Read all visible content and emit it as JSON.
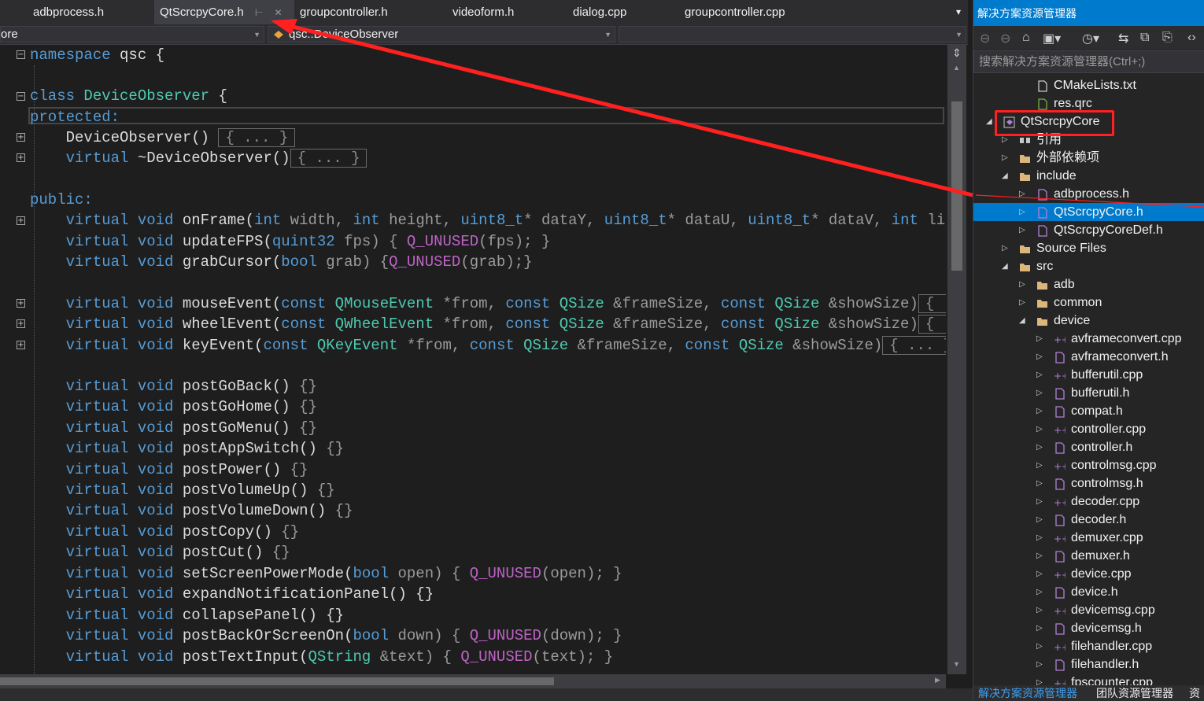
{
  "tabs": [
    {
      "label": "adbprocess.h"
    },
    {
      "label": "QtScrcpyCore.h",
      "pin": "⊢",
      "close": "✕"
    },
    {
      "label": "groupcontroller.h"
    },
    {
      "label": "videoform.h"
    },
    {
      "label": "dialog.cpp"
    },
    {
      "label": "groupcontroller.cpp"
    }
  ],
  "tab_menu_icon": "▾",
  "nav": {
    "project": "ore",
    "scope": "qsc::DeviceObserver",
    "member": ""
  },
  "code_lines": {
    "l1_kw": "namespace",
    "l1_rest": " qsc {",
    "l3_kw": "class",
    "l3_ty": "DeviceObserver",
    "l3_rest": " {",
    "l4": "protected:",
    "l5_name": "    DeviceObserver()",
    "l5_box": "{ ... }",
    "l6_kw": "    virtual",
    "l6_name": " ~DeviceObserver()",
    "l6_box": "{ ... }",
    "l8": "public:",
    "l9_a": "    virtual void",
    "l9_b": " onFrame(",
    "l9_c": "int",
    "l9_d": " width, ",
    "l9_e": "int",
    "l9_f": " height, ",
    "l9_g": "uint8_t",
    "l9_h": "* dataY, ",
    "l9_i": "uint8_t",
    "l9_j": "* dataU, ",
    "l9_k": "uint8_t",
    "l9_l": "* dataV, ",
    "l9_m": "int",
    "l9_n": " linesizeY",
    "l10_a": "    virtual void",
    "l10_b": " updateFPS(",
    "l10_c": "quint32",
    "l10_d": " fps) { ",
    "l10_e": "Q_UNUSED",
    "l10_f": "(fps); }",
    "l11_a": "    virtual void",
    "l11_b": " grabCursor(",
    "l11_c": "bool",
    "l11_d": " grab) {",
    "l11_e": "Q_UNUSED",
    "l11_f": "(grab);}",
    "l13_a": "    virtual void",
    "l13_b": " mouseEvent(",
    "l13_c": "const",
    "l13_d": " QMouseEvent",
    "l13_e": " *from, ",
    "l13_f": "const",
    "l13_g": " QSize",
    "l13_h": " &frameSize, ",
    "l13_i": "const",
    "l13_j": " QSize",
    "l13_k": " &showSize)",
    "l13_box": "{ ... }",
    "l14_a": "    virtual void",
    "l14_b": " wheelEvent(",
    "l14_c": "const",
    "l14_d": " QWheelEvent",
    "l14_e": " *from, ",
    "l14_f": "const",
    "l14_g": " QSize",
    "l14_h": " &frameSize, ",
    "l14_i": "const",
    "l14_j": " QSize",
    "l14_k": " &showSize)",
    "l14_box": "{ ... }",
    "l15_a": "    virtual void",
    "l15_b": " keyEvent(",
    "l15_c": "const",
    "l15_d": " QKeyEvent",
    "l15_e": " *from, ",
    "l15_f": "const",
    "l15_g": " QSize",
    "l15_h": " &frameSize, ",
    "l15_i": "const",
    "l15_j": " QSize",
    "l15_k": " &showSize)",
    "l15_box": "{ ... }"
  },
  "simple_methods": [
    {
      "kw": "    virtual void",
      "name": " postGoBack()",
      "body": " {}"
    },
    {
      "kw": "    virtual void",
      "name": " postGoHome()",
      "body": " {}"
    },
    {
      "kw": "    virtual void",
      "name": " postGoMenu()",
      "body": " {}"
    },
    {
      "kw": "    virtual void",
      "name": " postAppSwitch()",
      "body": " {}"
    },
    {
      "kw": "    virtual void",
      "name": " postPower()",
      "body": " {}"
    },
    {
      "kw": "    virtual void",
      "name": " postVolumeUp()",
      "body": " {}"
    },
    {
      "kw": "    virtual void",
      "name": " postVolumeDown()",
      "body": " {}"
    },
    {
      "kw": "    virtual void",
      "name": " postCopy()",
      "body": " {}"
    },
    {
      "kw": "    virtual void",
      "name": " postCut()",
      "body": " {}"
    }
  ],
  "tail_lines": {
    "t1_a": "    virtual void",
    "t1_b": " setScreenPowerMode(",
    "t1_c": "bool",
    "t1_d": " open) { ",
    "t1_e": "Q_UNUSED",
    "t1_f": "(open); }",
    "t2_a": "    virtual void",
    "t2_b": " expandNotificationPanel() {}",
    "t3_a": "    virtual void",
    "t3_b": " collapsePanel() {}",
    "t4_a": "    virtual void",
    "t4_b": " postBackOrScreenOn(",
    "t4_c": "bool",
    "t4_d": " down) { ",
    "t4_e": "Q_UNUSED",
    "t4_f": "(down); }",
    "t5_a": "    virtual void",
    "t5_b": " postTextInput(",
    "t5_c": "QString",
    "t5_d": " &text) { ",
    "t5_e": "Q_UNUSED",
    "t5_f": "(text); }"
  },
  "solution_explorer": {
    "title": "解决方案资源管理器",
    "search_placeholder": "搜索解决方案资源管理器(Ctrl+;)",
    "toolbar_icons": [
      "back-icon",
      "forward-icon",
      "home-icon",
      "switch-views-icon",
      "history-icon",
      "sync-icon",
      "collapse-all-icon",
      "show-all-files-icon",
      "code-view-icon"
    ],
    "tree": [
      {
        "label": "CMakeLists.txt",
        "level": 2,
        "arrow": "",
        "icon": "file-icon"
      },
      {
        "label": "res.qrc",
        "level": 2,
        "arrow": "",
        "icon": "qrc-icon"
      },
      {
        "label": "QtScrcpyCore",
        "level": 0,
        "arrow": "◢",
        "icon": "project-icon"
      },
      {
        "label": "引用",
        "level": 1,
        "arrow": "▷",
        "icon": "references-icon"
      },
      {
        "label": "外部依赖项",
        "level": 1,
        "arrow": "▷",
        "icon": "external-deps-icon"
      },
      {
        "label": "include",
        "level": 1,
        "arrow": "◢",
        "icon": "folder-icon"
      },
      {
        "label": "adbprocess.h",
        "level": 2,
        "arrow": "▷",
        "icon": "header-icon"
      },
      {
        "label": "QtScrcpyCore.h",
        "level": 2,
        "arrow": "▷",
        "icon": "header-icon",
        "selected": true
      },
      {
        "label": "QtScrcpyCoreDef.h",
        "level": 2,
        "arrow": "▷",
        "icon": "header-icon"
      },
      {
        "label": "Source Files",
        "level": 1,
        "arrow": "▷",
        "icon": "folder-icon"
      },
      {
        "label": "src",
        "level": 1,
        "arrow": "◢",
        "icon": "folder-icon"
      },
      {
        "label": "adb",
        "level": 2,
        "arrow": "▷",
        "icon": "folder-icon"
      },
      {
        "label": "common",
        "level": 2,
        "arrow": "▷",
        "icon": "folder-icon"
      },
      {
        "label": "device",
        "level": 2,
        "arrow": "◢",
        "icon": "folder-icon"
      },
      {
        "label": "avframeconvert.cpp",
        "level": 3,
        "arrow": "▷",
        "icon": "cpp-icon"
      },
      {
        "label": "avframeconvert.h",
        "level": 3,
        "arrow": "▷",
        "icon": "header-icon"
      },
      {
        "label": "bufferutil.cpp",
        "level": 3,
        "arrow": "▷",
        "icon": "cpp-icon"
      },
      {
        "label": "bufferutil.h",
        "level": 3,
        "arrow": "▷",
        "icon": "header-icon"
      },
      {
        "label": "compat.h",
        "level": 3,
        "arrow": "▷",
        "icon": "header-icon"
      },
      {
        "label": "controller.cpp",
        "level": 3,
        "arrow": "▷",
        "icon": "cpp-icon"
      },
      {
        "label": "controller.h",
        "level": 3,
        "arrow": "▷",
        "icon": "header-icon"
      },
      {
        "label": "controlmsg.cpp",
        "level": 3,
        "arrow": "▷",
        "icon": "cpp-icon"
      },
      {
        "label": "controlmsg.h",
        "level": 3,
        "arrow": "▷",
        "icon": "header-icon"
      },
      {
        "label": "decoder.cpp",
        "level": 3,
        "arrow": "▷",
        "icon": "cpp-icon"
      },
      {
        "label": "decoder.h",
        "level": 3,
        "arrow": "▷",
        "icon": "header-icon"
      },
      {
        "label": "demuxer.cpp",
        "level": 3,
        "arrow": "▷",
        "icon": "cpp-icon"
      },
      {
        "label": "demuxer.h",
        "level": 3,
        "arrow": "▷",
        "icon": "header-icon"
      },
      {
        "label": "device.cpp",
        "level": 3,
        "arrow": "▷",
        "icon": "cpp-icon"
      },
      {
        "label": "device.h",
        "level": 3,
        "arrow": "▷",
        "icon": "header-icon"
      },
      {
        "label": "devicemsg.cpp",
        "level": 3,
        "arrow": "▷",
        "icon": "cpp-icon"
      },
      {
        "label": "devicemsg.h",
        "level": 3,
        "arrow": "▷",
        "icon": "header-icon"
      },
      {
        "label": "filehandler.cpp",
        "level": 3,
        "arrow": "▷",
        "icon": "cpp-icon"
      },
      {
        "label": "filehandler.h",
        "level": 3,
        "arrow": "▷",
        "icon": "header-icon"
      },
      {
        "label": "fpscounter.cpp",
        "level": 3,
        "arrow": "▷",
        "icon": "cpp-icon"
      }
    ],
    "bottom_tabs": [
      "解决方案资源管理器",
      "团队资源管理器",
      "资"
    ]
  },
  "colors": {
    "accent": "#007acc",
    "annotation": "#ff2020",
    "keyword": "#569cd6",
    "type": "#4ec9b0",
    "macro": "#bd63c5"
  }
}
